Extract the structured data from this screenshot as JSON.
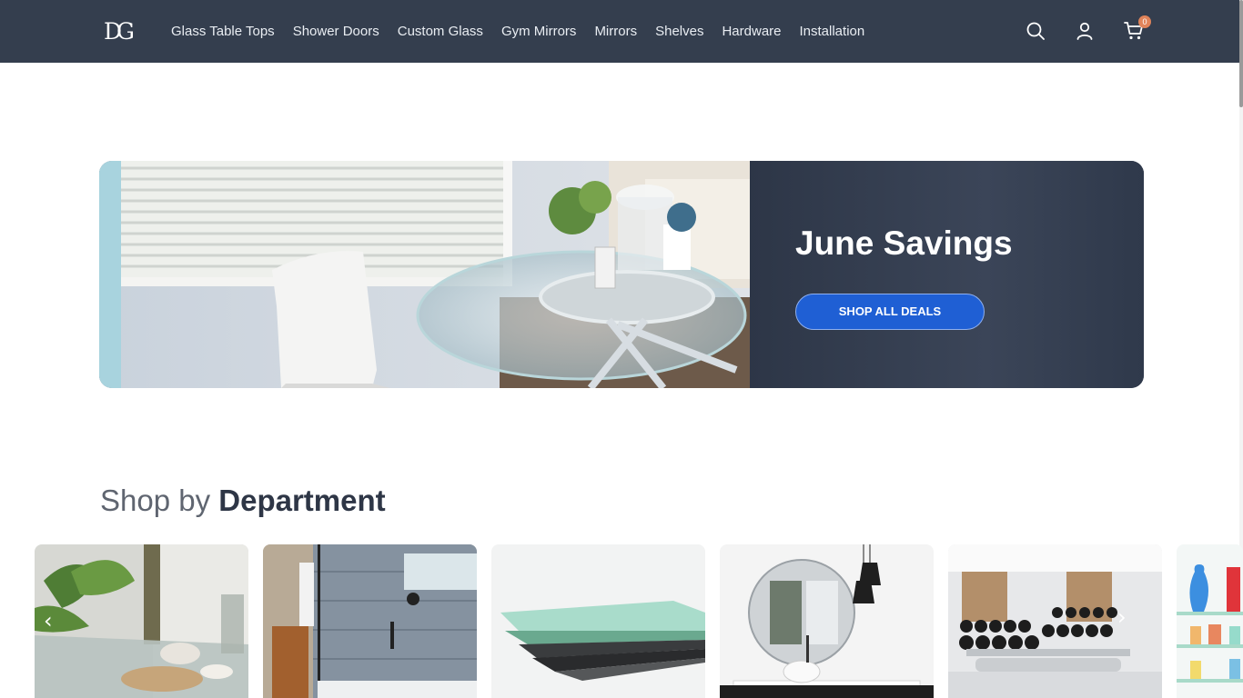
{
  "header": {
    "logo_text": "DG",
    "nav": [
      "Glass Table Tops",
      "Shower Doors",
      "Custom Glass",
      "Gym Mirrors",
      "Mirrors",
      "Shelves",
      "Hardware",
      "Installation"
    ],
    "icons": [
      "search-icon",
      "account-icon",
      "cart-icon"
    ],
    "cart_count": "0"
  },
  "hero": {
    "title": "June Savings",
    "button": "SHOP ALL DEALS"
  },
  "department": {
    "title_light": "Shop by",
    "title_bold": "Department",
    "tiles": [
      "glass-table-tops-tile",
      "shower-doors-tile",
      "custom-glass-tile",
      "mirrors-tile",
      "gym-mirrors-tile",
      "shelves-tile"
    ]
  },
  "colors": {
    "header_bg": "#343e4e",
    "accent": "#1f5fd4",
    "badge": "#e0845a"
  }
}
